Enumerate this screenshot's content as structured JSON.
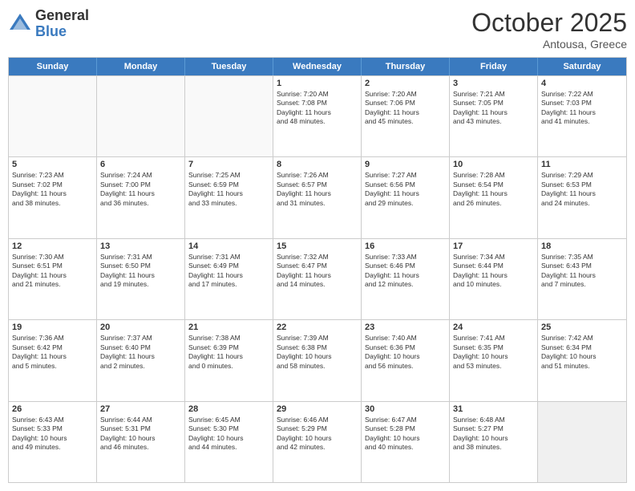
{
  "header": {
    "logo_general": "General",
    "logo_blue": "Blue",
    "month_title": "October 2025",
    "subtitle": "Antousa, Greece"
  },
  "days_of_week": [
    "Sunday",
    "Monday",
    "Tuesday",
    "Wednesday",
    "Thursday",
    "Friday",
    "Saturday"
  ],
  "rows": [
    [
      {
        "day": "",
        "lines": []
      },
      {
        "day": "",
        "lines": []
      },
      {
        "day": "",
        "lines": []
      },
      {
        "day": "1",
        "lines": [
          "Sunrise: 7:20 AM",
          "Sunset: 7:08 PM",
          "Daylight: 11 hours",
          "and 48 minutes."
        ]
      },
      {
        "day": "2",
        "lines": [
          "Sunrise: 7:20 AM",
          "Sunset: 7:06 PM",
          "Daylight: 11 hours",
          "and 45 minutes."
        ]
      },
      {
        "day": "3",
        "lines": [
          "Sunrise: 7:21 AM",
          "Sunset: 7:05 PM",
          "Daylight: 11 hours",
          "and 43 minutes."
        ]
      },
      {
        "day": "4",
        "lines": [
          "Sunrise: 7:22 AM",
          "Sunset: 7:03 PM",
          "Daylight: 11 hours",
          "and 41 minutes."
        ]
      }
    ],
    [
      {
        "day": "5",
        "lines": [
          "Sunrise: 7:23 AM",
          "Sunset: 7:02 PM",
          "Daylight: 11 hours",
          "and 38 minutes."
        ]
      },
      {
        "day": "6",
        "lines": [
          "Sunrise: 7:24 AM",
          "Sunset: 7:00 PM",
          "Daylight: 11 hours",
          "and 36 minutes."
        ]
      },
      {
        "day": "7",
        "lines": [
          "Sunrise: 7:25 AM",
          "Sunset: 6:59 PM",
          "Daylight: 11 hours",
          "and 33 minutes."
        ]
      },
      {
        "day": "8",
        "lines": [
          "Sunrise: 7:26 AM",
          "Sunset: 6:57 PM",
          "Daylight: 11 hours",
          "and 31 minutes."
        ]
      },
      {
        "day": "9",
        "lines": [
          "Sunrise: 7:27 AM",
          "Sunset: 6:56 PM",
          "Daylight: 11 hours",
          "and 29 minutes."
        ]
      },
      {
        "day": "10",
        "lines": [
          "Sunrise: 7:28 AM",
          "Sunset: 6:54 PM",
          "Daylight: 11 hours",
          "and 26 minutes."
        ]
      },
      {
        "day": "11",
        "lines": [
          "Sunrise: 7:29 AM",
          "Sunset: 6:53 PM",
          "Daylight: 11 hours",
          "and 24 minutes."
        ]
      }
    ],
    [
      {
        "day": "12",
        "lines": [
          "Sunrise: 7:30 AM",
          "Sunset: 6:51 PM",
          "Daylight: 11 hours",
          "and 21 minutes."
        ]
      },
      {
        "day": "13",
        "lines": [
          "Sunrise: 7:31 AM",
          "Sunset: 6:50 PM",
          "Daylight: 11 hours",
          "and 19 minutes."
        ]
      },
      {
        "day": "14",
        "lines": [
          "Sunrise: 7:31 AM",
          "Sunset: 6:49 PM",
          "Daylight: 11 hours",
          "and 17 minutes."
        ]
      },
      {
        "day": "15",
        "lines": [
          "Sunrise: 7:32 AM",
          "Sunset: 6:47 PM",
          "Daylight: 11 hours",
          "and 14 minutes."
        ]
      },
      {
        "day": "16",
        "lines": [
          "Sunrise: 7:33 AM",
          "Sunset: 6:46 PM",
          "Daylight: 11 hours",
          "and 12 minutes."
        ]
      },
      {
        "day": "17",
        "lines": [
          "Sunrise: 7:34 AM",
          "Sunset: 6:44 PM",
          "Daylight: 11 hours",
          "and 10 minutes."
        ]
      },
      {
        "day": "18",
        "lines": [
          "Sunrise: 7:35 AM",
          "Sunset: 6:43 PM",
          "Daylight: 11 hours",
          "and 7 minutes."
        ]
      }
    ],
    [
      {
        "day": "19",
        "lines": [
          "Sunrise: 7:36 AM",
          "Sunset: 6:42 PM",
          "Daylight: 11 hours",
          "and 5 minutes."
        ]
      },
      {
        "day": "20",
        "lines": [
          "Sunrise: 7:37 AM",
          "Sunset: 6:40 PM",
          "Daylight: 11 hours",
          "and 2 minutes."
        ]
      },
      {
        "day": "21",
        "lines": [
          "Sunrise: 7:38 AM",
          "Sunset: 6:39 PM",
          "Daylight: 11 hours",
          "and 0 minutes."
        ]
      },
      {
        "day": "22",
        "lines": [
          "Sunrise: 7:39 AM",
          "Sunset: 6:38 PM",
          "Daylight: 10 hours",
          "and 58 minutes."
        ]
      },
      {
        "day": "23",
        "lines": [
          "Sunrise: 7:40 AM",
          "Sunset: 6:36 PM",
          "Daylight: 10 hours",
          "and 56 minutes."
        ]
      },
      {
        "day": "24",
        "lines": [
          "Sunrise: 7:41 AM",
          "Sunset: 6:35 PM",
          "Daylight: 10 hours",
          "and 53 minutes."
        ]
      },
      {
        "day": "25",
        "lines": [
          "Sunrise: 7:42 AM",
          "Sunset: 6:34 PM",
          "Daylight: 10 hours",
          "and 51 minutes."
        ]
      }
    ],
    [
      {
        "day": "26",
        "lines": [
          "Sunrise: 6:43 AM",
          "Sunset: 5:33 PM",
          "Daylight: 10 hours",
          "and 49 minutes."
        ]
      },
      {
        "day": "27",
        "lines": [
          "Sunrise: 6:44 AM",
          "Sunset: 5:31 PM",
          "Daylight: 10 hours",
          "and 46 minutes."
        ]
      },
      {
        "day": "28",
        "lines": [
          "Sunrise: 6:45 AM",
          "Sunset: 5:30 PM",
          "Daylight: 10 hours",
          "and 44 minutes."
        ]
      },
      {
        "day": "29",
        "lines": [
          "Sunrise: 6:46 AM",
          "Sunset: 5:29 PM",
          "Daylight: 10 hours",
          "and 42 minutes."
        ]
      },
      {
        "day": "30",
        "lines": [
          "Sunrise: 6:47 AM",
          "Sunset: 5:28 PM",
          "Daylight: 10 hours",
          "and 40 minutes."
        ]
      },
      {
        "day": "31",
        "lines": [
          "Sunrise: 6:48 AM",
          "Sunset: 5:27 PM",
          "Daylight: 10 hours",
          "and 38 minutes."
        ]
      },
      {
        "day": "",
        "lines": []
      }
    ]
  ]
}
